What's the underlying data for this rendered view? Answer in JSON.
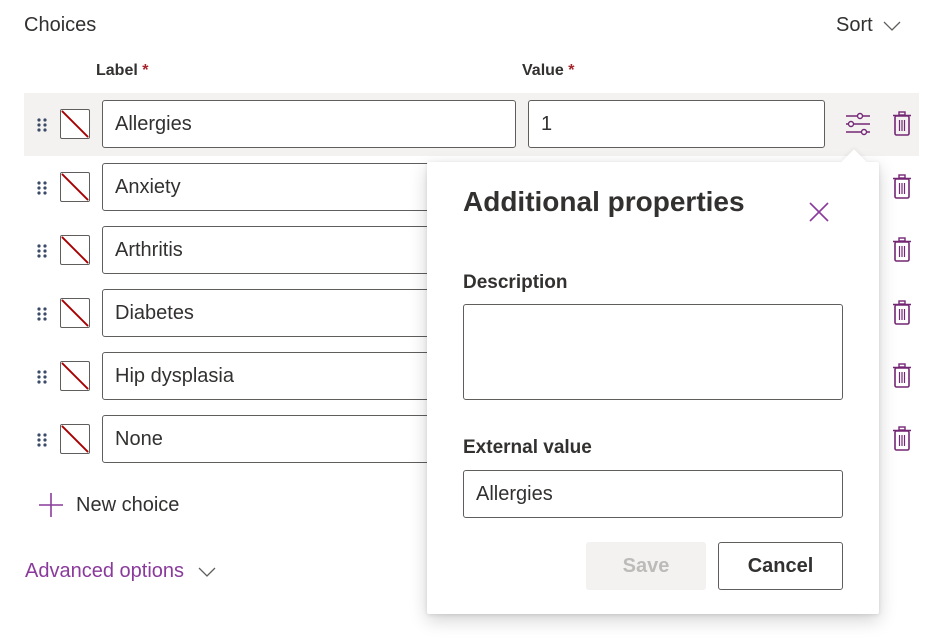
{
  "header": {
    "title": "Choices",
    "sort_label": "Sort"
  },
  "columns": {
    "label": "Label",
    "value": "Value",
    "required_marker": "*"
  },
  "choices": [
    {
      "label": "Allergies",
      "value": "1",
      "selected": true
    },
    {
      "label": "Anxiety",
      "value": ""
    },
    {
      "label": "Arthritis",
      "value": ""
    },
    {
      "label": "Diabetes",
      "value": ""
    },
    {
      "label": "Hip dysplasia",
      "value": ""
    },
    {
      "label": "None",
      "value": ""
    }
  ],
  "actions": {
    "new_choice": "New choice",
    "advanced_options": "Advanced options"
  },
  "popup": {
    "title": "Additional properties",
    "description_label": "Description",
    "description_value": "",
    "external_value_label": "External value",
    "external_value": "Allergies",
    "save_label": "Save",
    "cancel_label": "Cancel"
  },
  "colors": {
    "accent": "#8a3a9c",
    "icon_purple": "#742774",
    "required": "#a4262c",
    "swatch_slash": "#a80000",
    "selected_row": "#f3f2f1",
    "disabled_bg": "#f3f2f1",
    "disabled_text": "#bdbbb8"
  }
}
